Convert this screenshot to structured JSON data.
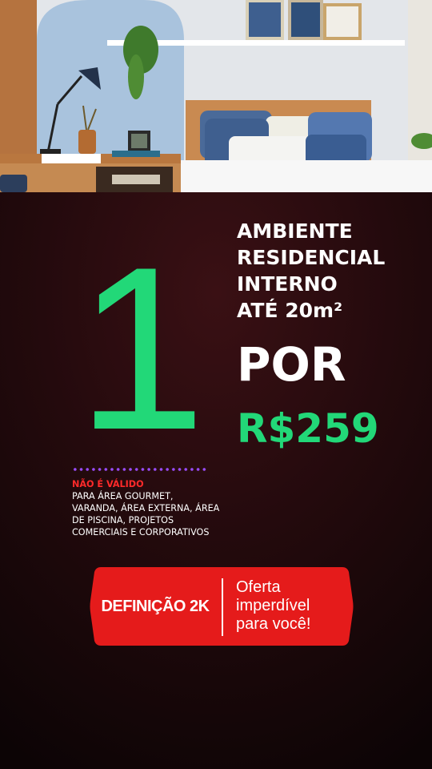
{
  "offer": {
    "quantity": "1",
    "headline_lines": [
      "AMBIENTE",
      "RESIDENCIAL",
      "INTERNO",
      "ATÉ 20m²"
    ],
    "connector": "POR",
    "price": "R$259"
  },
  "disclaimer": {
    "title": "NÃO É VÁLIDO",
    "lines": [
      "PARA ÁREA GOURMET,",
      "VARANDA, ÁREA EXTERNA, ÁREA",
      "DE PISCINA, PROJETOS",
      "COMERCIAIS E CORPORATIVOS"
    ]
  },
  "banner": {
    "resolution_label": "DEFINIÇÃO 2K",
    "tagline_lines": [
      "Oferta",
      "imperdível",
      "para você!"
    ]
  },
  "colors": {
    "accent_green": "#22d878",
    "banner_red": "#e51b1b",
    "warning_red": "#ff2a2a",
    "dots_purple": "#9a4cff"
  }
}
